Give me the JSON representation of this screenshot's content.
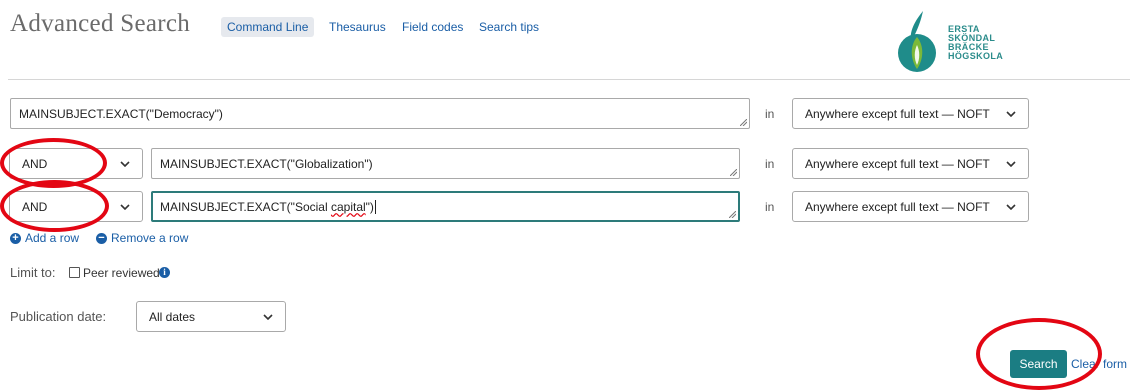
{
  "header": {
    "title": "Advanced Search",
    "links": [
      {
        "label": "Command Line",
        "active": true
      },
      {
        "label": "Thesaurus",
        "active": false
      },
      {
        "label": "Field codes",
        "active": false
      },
      {
        "label": "Search tips",
        "active": false
      }
    ]
  },
  "logo": {
    "lines": [
      "ERSTA",
      "SKÖNDAL",
      "BRÄCKE",
      "HÖGSKOLA"
    ],
    "colors": {
      "teal": "#1f8c8a",
      "green": "#7bb93a"
    }
  },
  "rows": [
    {
      "operator": null,
      "query": "MAINSUBJECT.EXACT(\"Democracy\")",
      "in_label": "in",
      "field": "Anywhere except full text — NOFT"
    },
    {
      "operator": "AND",
      "query": "MAINSUBJECT.EXACT(\"Globalization\")",
      "in_label": "in",
      "field": "Anywhere except full text — NOFT"
    },
    {
      "operator": "AND",
      "query_prefix": "MAINSUBJECT.EXACT(\"Social ",
      "query_flagged": "capital",
      "query_suffix": "\")",
      "in_label": "in",
      "field": "Anywhere except full text — NOFT",
      "focused": true
    }
  ],
  "row_actions": {
    "add": "Add a row",
    "remove": "Remove a row"
  },
  "limit": {
    "label": "Limit to:",
    "checkbox_label": "Peer reviewed",
    "checked": false
  },
  "pubdate": {
    "label": "Publication date:",
    "value": "All dates"
  },
  "actions": {
    "search": "Search",
    "clear": "Clear form"
  },
  "colors": {
    "accent": "#1b7d83",
    "link": "#1a5ea6",
    "annotation": "#e30613"
  }
}
